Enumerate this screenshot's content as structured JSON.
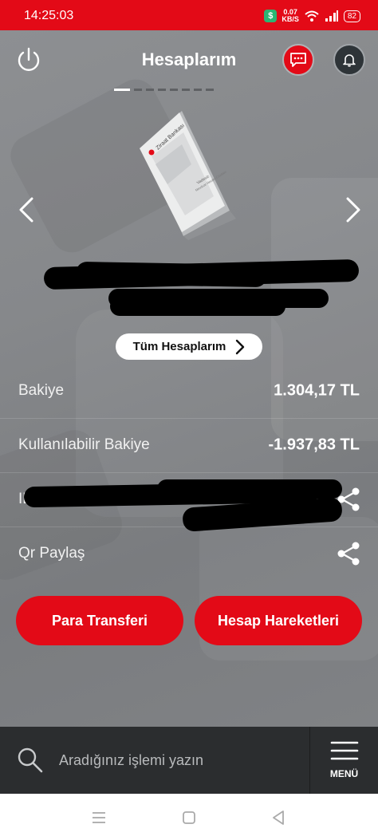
{
  "status": {
    "time": "14:25:03",
    "speed_value": "0.07",
    "speed_unit": "KB/S",
    "battery": "82"
  },
  "header": {
    "title": "Hesaplarım"
  },
  "account": {
    "all_accounts_label": "Tüm Hesaplarım"
  },
  "rows": {
    "balance_label": "Bakiye",
    "balance_value": "1.304,17 TL",
    "available_label": "Kullanılabilir Bakiye",
    "available_value": "-1.937,83 TL",
    "iban_label": "IBAN",
    "qr_label": "Qr Paylaş"
  },
  "actions": {
    "transfer_label": "Para Transferi",
    "history_label": "Hesap Hareketleri"
  },
  "bottom": {
    "search_placeholder": "Aradığınız işlemi yazın",
    "menu_label": "MENÜ"
  },
  "colors": {
    "brand_red": "#e30a17",
    "bottom_bar": "#2b2d2f",
    "background": "#808285"
  },
  "card": {
    "brand": "Ziraat Bankası",
    "product_line1": "Vadesiz",
    "product_line2": "Mevduat Hesabı Cüzdanı"
  },
  "icons": [
    "power-icon",
    "message-icon",
    "bell-icon",
    "chevron-left-icon",
    "chevron-right-icon",
    "share-icon",
    "search-icon",
    "menu-icon"
  ]
}
